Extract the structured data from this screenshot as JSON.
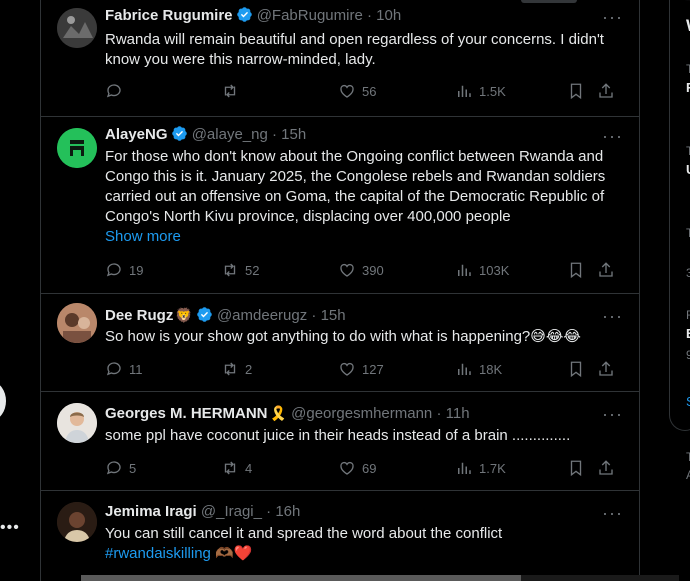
{
  "tweets": [
    {
      "name": "Fabrice Rugumire",
      "handle": "@FabRugumire",
      "time": "10h",
      "text": "Rwanda will remain beautiful and open regardless of your concerns. I didn't know you were this narrow-minded, lady.",
      "replies": "",
      "retweets": "",
      "likes": "56",
      "views": "1.5K"
    },
    {
      "name": "AlayeNG",
      "handle": "@alaye_ng",
      "time": "15h",
      "text": "For those who don't know about the Ongoing conflict between Rwanda and Congo this is it. January 2025, the Congolese rebels and Rwandan soldiers carried out an offensive on Goma, the capital of the Democratic Republic of Congo's North Kivu province, displacing over 400,000 people",
      "show_more": "Show more",
      "replies": "19",
      "retweets": "52",
      "likes": "390",
      "views": "103K"
    },
    {
      "name": "Dee Rugz",
      "badge": "🦁",
      "handle": "@amdeerugz",
      "time": "15h",
      "text": "So how is your show got anything to do with what is happening?😅😂😂",
      "replies": "11",
      "retweets": "2",
      "likes": "127",
      "views": "18K"
    },
    {
      "name": "Georges M. HERMANN",
      "badge": "🎗️",
      "handle": "@georgesmhermann",
      "time": "11h",
      "text": "some ppl have coconut juice in their heads instead of a brain ..............",
      "replies": "5",
      "retweets": "4",
      "likes": "69",
      "views": "1.7K"
    },
    {
      "name": "Jemima Iragi",
      "handle": "@_Iragi_",
      "time": "16h",
      "text": "You can still cancel it and spread the word about the conflict",
      "hashtag": "#rwandaiskilling",
      "trailing_emoji": "🫶🏾❤️"
    }
  ],
  "sidebar_fragments": {
    "first": "W",
    "s1": "T",
    "s2": "F",
    "s3": "T",
    "s4": "U",
    "s5": "T",
    "s6": "3",
    "s7": "F",
    "s8": "E",
    "s9": "9",
    "link": "S",
    "s10": "T",
    "s11": "A"
  },
  "icons": {
    "reply": "reply-icon",
    "retweet": "retweet-icon",
    "like": "heart-icon",
    "views": "views-icon",
    "bookmark": "bookmark-icon",
    "share": "share-icon",
    "verified": "verified-badge-icon"
  },
  "colors": {
    "background": "#000000",
    "text": "#e7e9ea",
    "muted": "#71767b",
    "accent": "#1d9bf0",
    "border": "#2f3336"
  }
}
